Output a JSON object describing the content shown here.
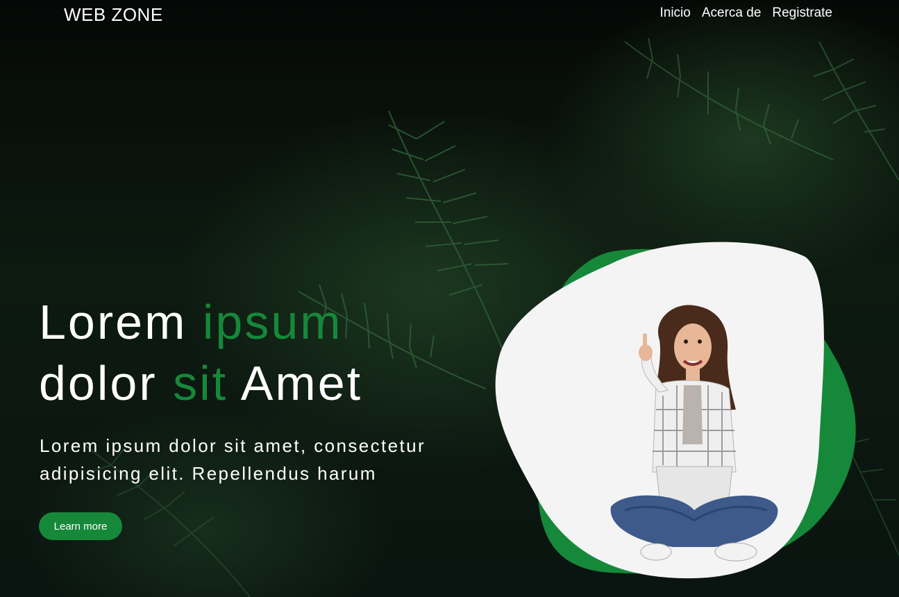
{
  "header": {
    "logo": "WEB ZONE",
    "nav": [
      "Inicio",
      "Acerca de",
      "Registrate"
    ]
  },
  "hero": {
    "title_line1_a": "Lorem ",
    "title_line1_b": "ipsum",
    "title_line2_a": "dolor ",
    "title_line2_b": "sit",
    "title_line2_c": " Amet",
    "subtitle_line1": "Lorem ipsum dolor sit amet, consectetur",
    "subtitle_line2": "adipisicing elit. Repellendus harum",
    "cta_label": "Learn more"
  },
  "colors": {
    "accent": "#16883a",
    "text": "#ffffff",
    "background": "#0b150e"
  },
  "icons": {
    "hero_image": "woman-with-laptop-illustration",
    "background_image": "pine-branches-photo"
  }
}
